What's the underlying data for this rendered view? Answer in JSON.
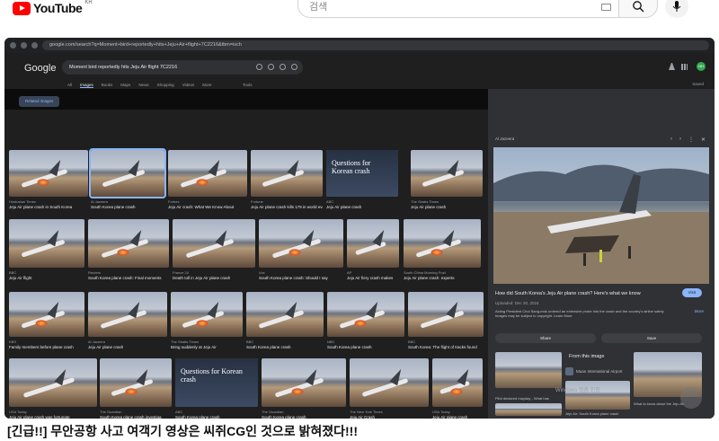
{
  "youtube": {
    "logo_text": "YouTube",
    "region": "KR",
    "search_placeholder": "검색"
  },
  "browser": {
    "url": "google.com/search?q=Moment+bird+reportedly+hits+Jeju+Air+flight+7C2216&tbm=isch"
  },
  "google": {
    "logo": "Google",
    "query": "Moment bird reportedly hits Jeju Air flight 7C2216",
    "avatar": "NH",
    "tabs": [
      "All",
      "Images",
      "Books",
      "Maps",
      "News",
      "Shopping",
      "Videos",
      "More"
    ],
    "tools": "Tools",
    "saved": "Saved",
    "chip": "Related images"
  },
  "grid": {
    "captions": [
      {
        "src": "Hindustan Times",
        "title": "Jeju Air plane crash in South Korea"
      },
      {
        "src": "Al Jazeera",
        "title": "South Korea plane crash"
      },
      {
        "src": "Forbes",
        "title": "Jeju Air crash: What We Know About"
      },
      {
        "src": "Fortune",
        "title": "Jeju Air plane crash kills 179 in world ever"
      },
      {
        "src": "ABC",
        "title": "Jeju Air plane crash"
      },
      {
        "src": "The Straits Times",
        "title": "Jeju Air plane crash"
      },
      {
        "src": "BBC",
        "title": "Jeju Air flight"
      },
      {
        "src": "Reuters",
        "title": "South Korea plane crash: Final moments"
      },
      {
        "src": "France 24",
        "title": "Death toll in Jeju Air plane crash"
      },
      {
        "src": "Vox",
        "title": "South Korea plane crash: Should I say"
      },
      {
        "src": "AP",
        "title": "Jeju Air fiery crash makes"
      },
      {
        "src": "South China Morning Post",
        "title": "Jeju Air plane crash: experts"
      },
      {
        "src": "KBS",
        "title": "Family members before plane crash"
      },
      {
        "src": "Al Jazeera",
        "title": "Jeju Air plane crash"
      },
      {
        "src": "The Straits Times",
        "title": "Bring suddenly at Jeju Air"
      },
      {
        "src": "BBC",
        "title": "South Korea plane crash"
      },
      {
        "src": "NBC",
        "title": "South Korea plane crash"
      },
      {
        "src": "BBC",
        "title": "South Korea: The flight of tracks found"
      },
      {
        "src": "USA Today",
        "title": "Jeju Air plane crash was fortunate"
      },
      {
        "src": "The Guardian",
        "title": "South Korea plane crash investiga"
      },
      {
        "src": "ABC",
        "title": "South Korea plane crash"
      },
      {
        "src": "The Guardian",
        "title": "South Korea plane crash"
      },
      {
        "src": "The New York Times",
        "title": "Jeju Air Crash"
      },
      {
        "src": "USA Today",
        "title": "Jeju Air plane crash"
      }
    ],
    "card_text": "Questions for Korean crash"
  },
  "panel": {
    "source": "Al Jazeera",
    "title": "How did South Korea's Jeju Air plane crash? Here's what we know",
    "date": "Uploaded: Dec 30, 2024",
    "description": "Acting President Choi Sang-mok ordered an extensive probe into the crash and the country's airline safety",
    "copyright": "Images may be subject to copyright. Learn More",
    "more": "More",
    "visit": "Visit",
    "share": "Share",
    "save": "Save",
    "related_title": "From this image",
    "site": "Muan International Airport",
    "related_caps": [
      "Pilot declared mayday - What has",
      "What to know about the Jeju Air",
      "Jeju Air: South Korea plane crash",
      "South Korea plane crash"
    ]
  },
  "video": {
    "title": "[긴급!!] 무안공항 사고 여객기 영상은 씨쥐CG인 것으로 밝혀졌다!!!",
    "watermark": "Windows 정품 인증"
  }
}
